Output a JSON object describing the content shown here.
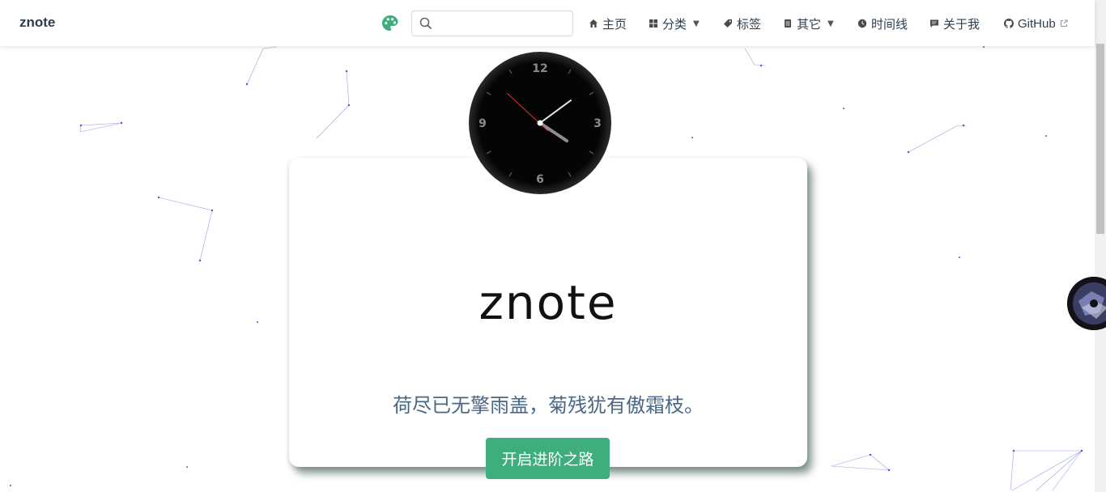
{
  "site": {
    "title": "znote"
  },
  "search": {
    "placeholder": "",
    "value": ""
  },
  "nav": {
    "home": "主页",
    "categories": "分类",
    "tags": "标签",
    "others": "其它",
    "timeline": "时间线",
    "about": "关于我",
    "github": "GitHub"
  },
  "clock": {
    "numerals": [
      "12",
      "3",
      "6",
      "9"
    ],
    "time_shown": "4:08:49"
  },
  "hero": {
    "logo_text": "znote",
    "motto": "荷尽已无擎雨盖，菊残犹有傲霜枝。",
    "cta_label": "开启进阶之路"
  },
  "colors": {
    "accent": "#3eaf7c",
    "motto": "#4a6784",
    "text": "#2c3e50",
    "clock_face": "#050505",
    "second_hand": "#e0321e"
  }
}
